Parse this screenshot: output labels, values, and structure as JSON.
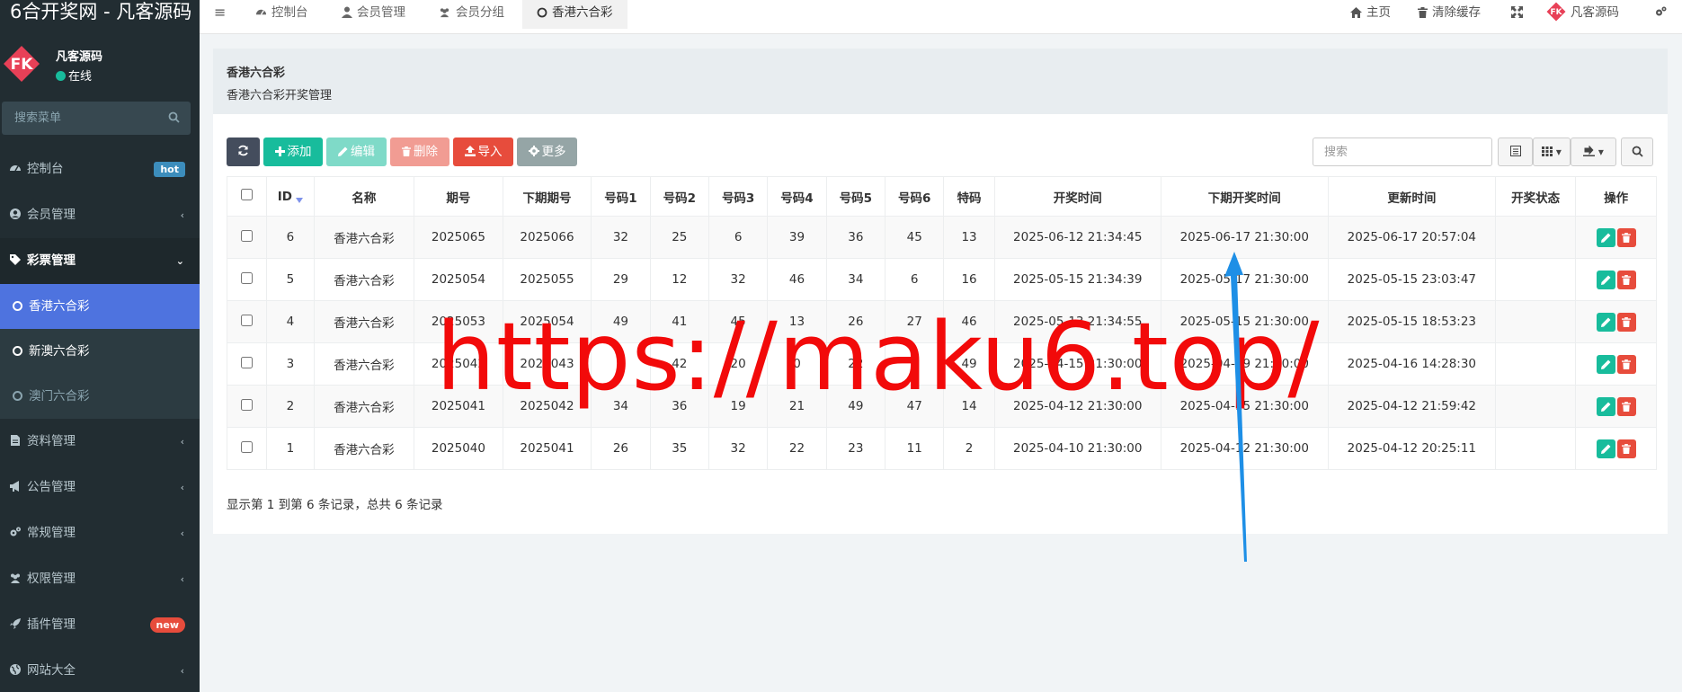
{
  "app": {
    "title": "6合开奖网 - 凡客源码"
  },
  "user": {
    "name": "凡客源码",
    "status": "在线"
  },
  "sidebar": {
    "search_placeholder": "搜索菜单",
    "items": [
      {
        "label": "控制台",
        "icon": "dashboard-icon",
        "badge": "hot"
      },
      {
        "label": "会员管理",
        "icon": "user-circle-icon"
      },
      {
        "label": "彩票管理",
        "icon": "tag-icon"
      },
      {
        "label": "资料管理",
        "icon": "file-icon"
      },
      {
        "label": "公告管理",
        "icon": "bullhorn-icon"
      },
      {
        "label": "常规管理",
        "icon": "cogs-icon"
      },
      {
        "label": "权限管理",
        "icon": "group-icon"
      },
      {
        "label": "插件管理",
        "icon": "rocket-icon",
        "badge": "new"
      },
      {
        "label": "网站大全",
        "icon": "globe-icon"
      }
    ],
    "submenu": [
      {
        "label": "香港六合彩"
      },
      {
        "label": "新澳六合彩"
      },
      {
        "label": "澳门六合彩"
      }
    ]
  },
  "navbar": {
    "tabs": [
      {
        "label": "控制台"
      },
      {
        "label": "会员管理"
      },
      {
        "label": "会员分组"
      },
      {
        "label": "香港六合彩"
      }
    ],
    "right": {
      "home": "主页",
      "clear_cache": "清除缓存",
      "user": "凡客源码"
    }
  },
  "page": {
    "title": "香港六合彩",
    "description": "香港六合彩开奖管理"
  },
  "toolbar": {
    "add": "添加",
    "edit": "编辑",
    "delete": "删除",
    "import": "导入",
    "more": "更多",
    "search_placeholder": "搜索"
  },
  "table": {
    "columns": [
      "ID",
      "名称",
      "期号",
      "下期期号",
      "号码1",
      "号码2",
      "号码3",
      "号码4",
      "号码5",
      "号码6",
      "特码",
      "开奖时间",
      "下期开奖时间",
      "更新时间",
      "开奖状态",
      "操作"
    ],
    "rows": [
      {
        "id": "6",
        "name": "香港六合彩",
        "issue": "2025065",
        "next_issue": "2025066",
        "n1": "32",
        "n2": "25",
        "n3": "6",
        "n4": "39",
        "n5": "36",
        "n6": "45",
        "special": "13",
        "draw_time": "2025-06-12 21:34:45",
        "next_draw_time": "2025-06-17 21:30:00",
        "updated": "2025-06-17 20:57:04",
        "status": ""
      },
      {
        "id": "5",
        "name": "香港六合彩",
        "issue": "2025054",
        "next_issue": "2025055",
        "n1": "29",
        "n2": "12",
        "n3": "32",
        "n4": "46",
        "n5": "34",
        "n6": "6",
        "special": "16",
        "draw_time": "2025-05-15 21:34:39",
        "next_draw_time": "2025-05-17 21:30:00",
        "updated": "2025-05-15 23:03:47",
        "status": ""
      },
      {
        "id": "4",
        "name": "香港六合彩",
        "issue": "2025053",
        "next_issue": "2025054",
        "n1": "49",
        "n2": "41",
        "n3": "45",
        "n4": "13",
        "n5": "26",
        "n6": "27",
        "special": "46",
        "draw_time": "2025-05-13 21:34:55",
        "next_draw_time": "2025-05-15 21:30:00",
        "updated": "2025-05-15 18:53:23",
        "status": ""
      },
      {
        "id": "3",
        "name": "香港六合彩",
        "issue": "2025042",
        "next_issue": "2025043",
        "n1": "2",
        "n2": "42",
        "n3": "20",
        "n4": "0",
        "n5": "22",
        "n6": "2",
        "special": "49",
        "draw_time": "2025-04-15 21:30:00",
        "next_draw_time": "2025-04-19 21:30:00",
        "updated": "2025-04-16 14:28:30",
        "status": ""
      },
      {
        "id": "2",
        "name": "香港六合彩",
        "issue": "2025041",
        "next_issue": "2025042",
        "n1": "34",
        "n2": "36",
        "n3": "19",
        "n4": "21",
        "n5": "49",
        "n6": "47",
        "special": "14",
        "draw_time": "2025-04-12 21:30:00",
        "next_draw_time": "2025-04-15 21:30:00",
        "updated": "2025-04-12 21:59:42",
        "status": ""
      },
      {
        "id": "1",
        "name": "香港六合彩",
        "issue": "2025040",
        "next_issue": "2025041",
        "n1": "26",
        "n2": "35",
        "n3": "32",
        "n4": "22",
        "n5": "23",
        "n6": "11",
        "special": "2",
        "draw_time": "2025-04-10 21:30:00",
        "next_draw_time": "2025-04-12 21:30:00",
        "updated": "2025-04-12 20:25:11",
        "status": ""
      }
    ]
  },
  "pagination": {
    "info": "显示第 1 到第 6 条记录，总共 6 条记录"
  },
  "watermark": "https://maku6.top/",
  "colors": {
    "sidebar_bg": "#222d32",
    "active_item": "#4e73df",
    "success": "#18bc9c",
    "danger": "#e74c3c",
    "watermark": "#f20a0a",
    "arrow": "#1e8fe6"
  }
}
